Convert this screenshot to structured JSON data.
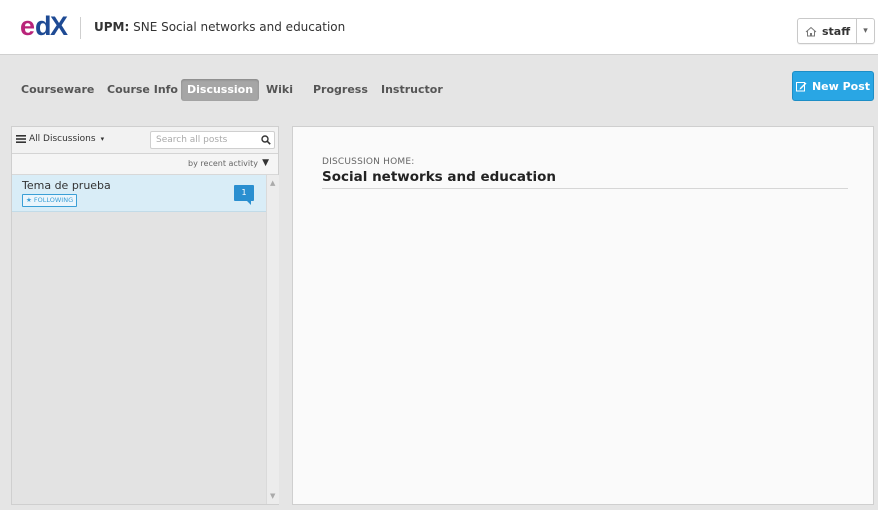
{
  "colors": {
    "edx_logo": "#1e4a94",
    "brand_magenta": "#b9247a",
    "new_post_blue": "#29a6e4",
    "active_tab_gray": "#a6a6a6",
    "selected_thread_bg": "#d9edf7",
    "badge_blue": "#2a8fd0"
  },
  "header": {
    "logo_alt": "edX",
    "course_org": "UPM:",
    "course_name": "SNE Social networks and education",
    "user": {
      "icon": "home-icon",
      "name": "staff",
      "caret": "▾"
    }
  },
  "tabs": [
    {
      "label": "Courseware",
      "active": false
    },
    {
      "label": "Course Info",
      "active": false
    },
    {
      "label": "Discussion",
      "active": true
    },
    {
      "label": "Wiki",
      "active": false
    },
    {
      "label": "Progress",
      "active": false
    },
    {
      "label": "Instructor",
      "active": false
    }
  ],
  "new_post": {
    "icon": "pencil-icon",
    "label": "New Post"
  },
  "sidebar": {
    "filter_label": "All Discussions",
    "filter_caret": "▾",
    "search_placeholder": "Search all posts",
    "sort_label": "by recent activity",
    "sort_caret": "▼",
    "threads": [
      {
        "title": "Tema de prueba",
        "badge": "★ FOLLOWING",
        "comment_count": "1"
      }
    ]
  },
  "main": {
    "home_label": "DISCUSSION HOME:",
    "home_title": "Social networks and education"
  }
}
